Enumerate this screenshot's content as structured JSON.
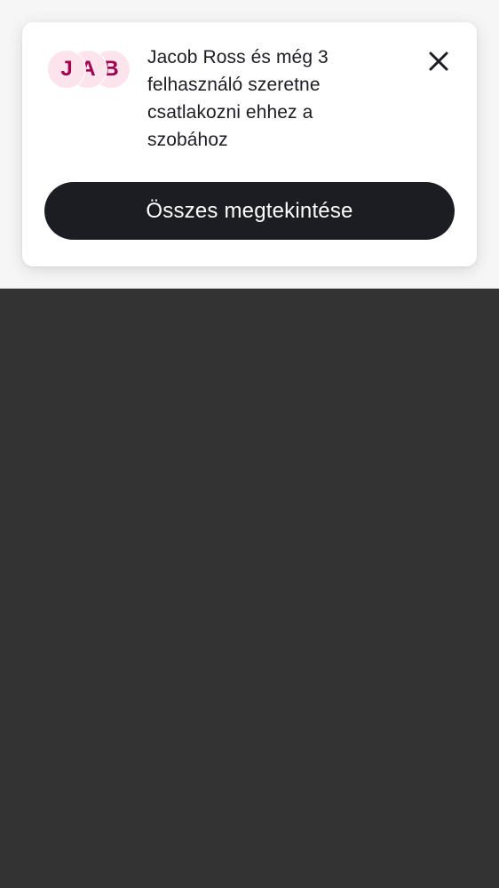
{
  "notification": {
    "avatars": [
      {
        "initial": "J",
        "color": "#a0004e",
        "bg": "#fde3ec"
      },
      {
        "initial": "A",
        "color": "#a0004e",
        "bg": "#fde3ec"
      },
      {
        "initial": "B",
        "color": "#a0004e",
        "bg": "#fde3ec"
      }
    ],
    "message": "Jacob Ross és még 3 felhasználó szeretne csatlakozni ehhez a szobához",
    "close_icon": "close-icon",
    "view_all_label": "Összes megtekintése"
  },
  "colors": {
    "card_bg": "#ffffff",
    "button_bg": "#1b1d22",
    "backdrop_top": "#f6f6f6",
    "backdrop_bottom": "#333333"
  }
}
